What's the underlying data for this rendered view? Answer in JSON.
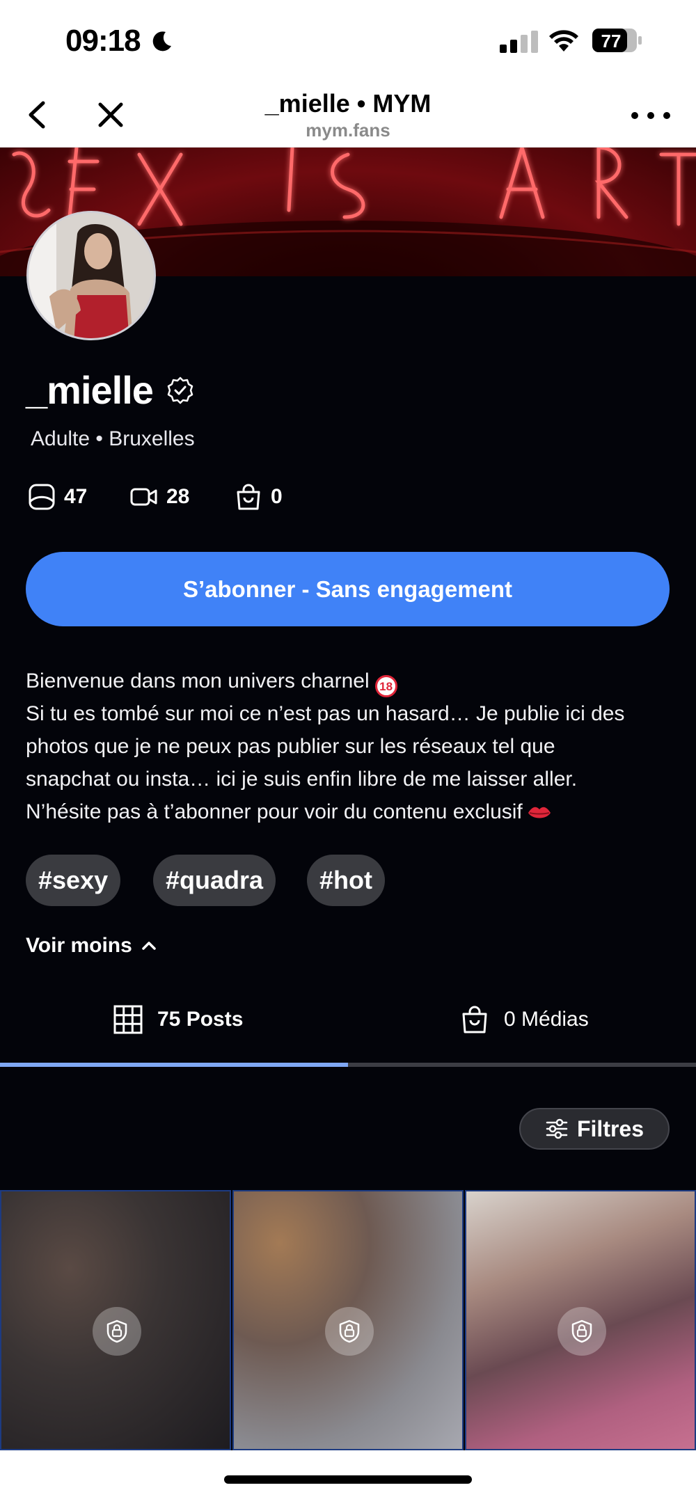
{
  "status_bar": {
    "time": "09:18",
    "battery": "77"
  },
  "browser": {
    "title": "_mielle • MYM",
    "url": "mym.fans"
  },
  "profile": {
    "username": "_mielle",
    "meta": "Adulte • Bruxelles",
    "stats": [
      {
        "icon": "photo-icon",
        "value": "47"
      },
      {
        "icon": "video-icon",
        "value": "28"
      },
      {
        "icon": "shopping-bag-icon",
        "value": "0"
      }
    ],
    "subscribe_label": "S’abonner - Sans engagement",
    "bio": {
      "line1": "Bienvenue dans mon univers charnel",
      "age_badge": "18",
      "line2": "Si tu es tombé sur moi ce n’est pas un hasard… Je publie ici des",
      "line3": "photos que je ne peux pas publier sur les réseaux tel que",
      "line4": "snapchat ou insta… ici je suis enfin libre de me laisser aller.",
      "line5": "N’hésite pas à t’abonner pour voir du contenu exclusif"
    },
    "tags": [
      "#sexy",
      "#quadra",
      "#hot"
    ],
    "see_less": "Voir moins"
  },
  "tabs": [
    {
      "label": "75 Posts",
      "active": true
    },
    {
      "label": "0 Médias",
      "active": false
    }
  ],
  "filters_label": "Filtres",
  "colors": {
    "accent": "#4082f7",
    "background": "#03040a",
    "tab_indicator": "#7fa8f4"
  }
}
